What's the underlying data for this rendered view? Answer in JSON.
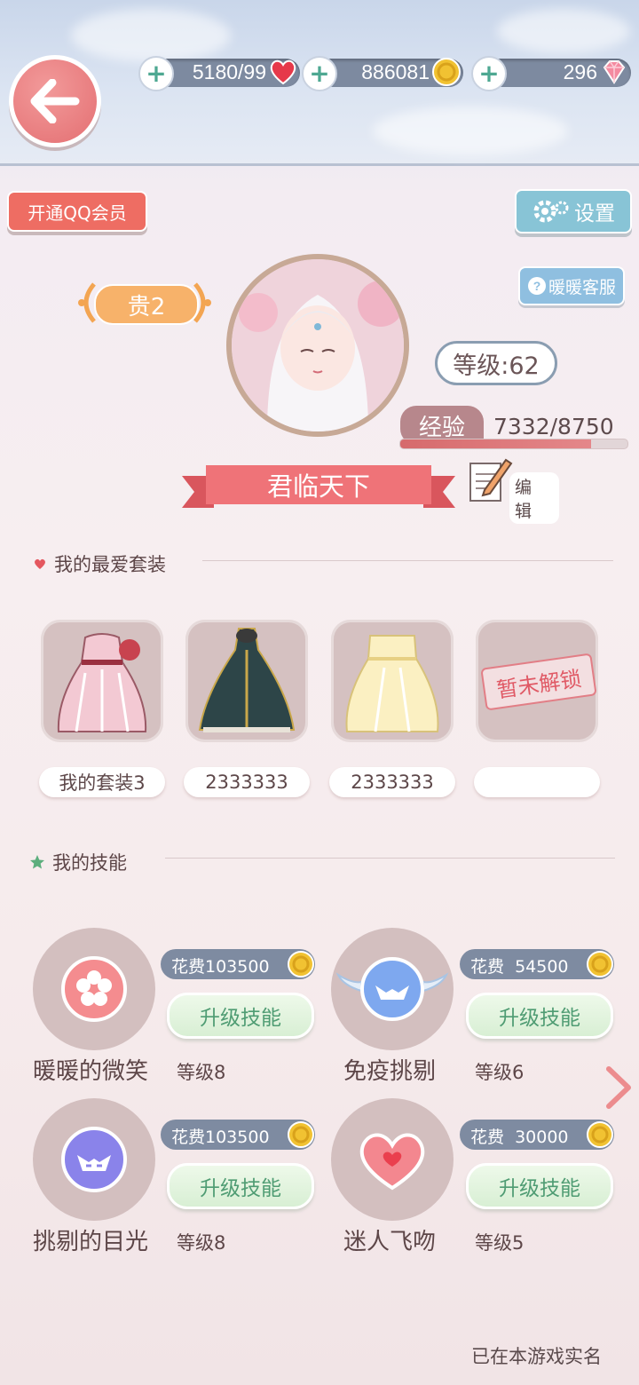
{
  "resources": {
    "stamina": {
      "value": "5180/99",
      "icon": "heart-icon"
    },
    "gold": {
      "value": "886081",
      "icon": "coin-icon"
    },
    "diamonds": {
      "value": "296",
      "icon": "diamond-icon"
    }
  },
  "header": {
    "qq_member_label": "开通QQ会员",
    "settings_label": "设置",
    "service_label": "暖暖客服"
  },
  "profile": {
    "vip_label": "贵2",
    "level_label": "等级:62",
    "exp_label": "经验",
    "exp_value": "7332/8750",
    "exp_progress": 0.838,
    "nickname": "君临天下",
    "edit_label": "编 辑"
  },
  "favorites": {
    "title": "我的最爱套装",
    "items": [
      {
        "name": "我的套装3",
        "locked": false
      },
      {
        "name": "2333333",
        "locked": false
      },
      {
        "name": "2333333",
        "locked": false
      },
      {
        "name": "",
        "locked": true,
        "locked_label": "暂未解锁"
      }
    ]
  },
  "skills": {
    "title": "我的技能",
    "upgrade_label": "升级技能",
    "items": [
      {
        "name": "暖暖的微笑",
        "level": "等级8",
        "cost": "花费103500",
        "icon": "sakura-orb-icon"
      },
      {
        "name": "免疫挑剔",
        "level": "等级6",
        "cost": "花费  54500",
        "icon": "winged-mask-orb-icon"
      },
      {
        "name": "挑剔的目光",
        "level": "等级8",
        "cost": "花费103500",
        "icon": "mask-orb-icon"
      },
      {
        "name": "迷人飞吻",
        "level": "等级5",
        "cost": "花费  30000",
        "icon": "heart-orb-icon"
      }
    ]
  },
  "footer": {
    "realname_label": "已在本游戏实名"
  },
  "colors": {
    "accent_red": "#e46f72",
    "panel_blue": "#7d8aa0",
    "upgrade_green": "#4f9c73"
  }
}
